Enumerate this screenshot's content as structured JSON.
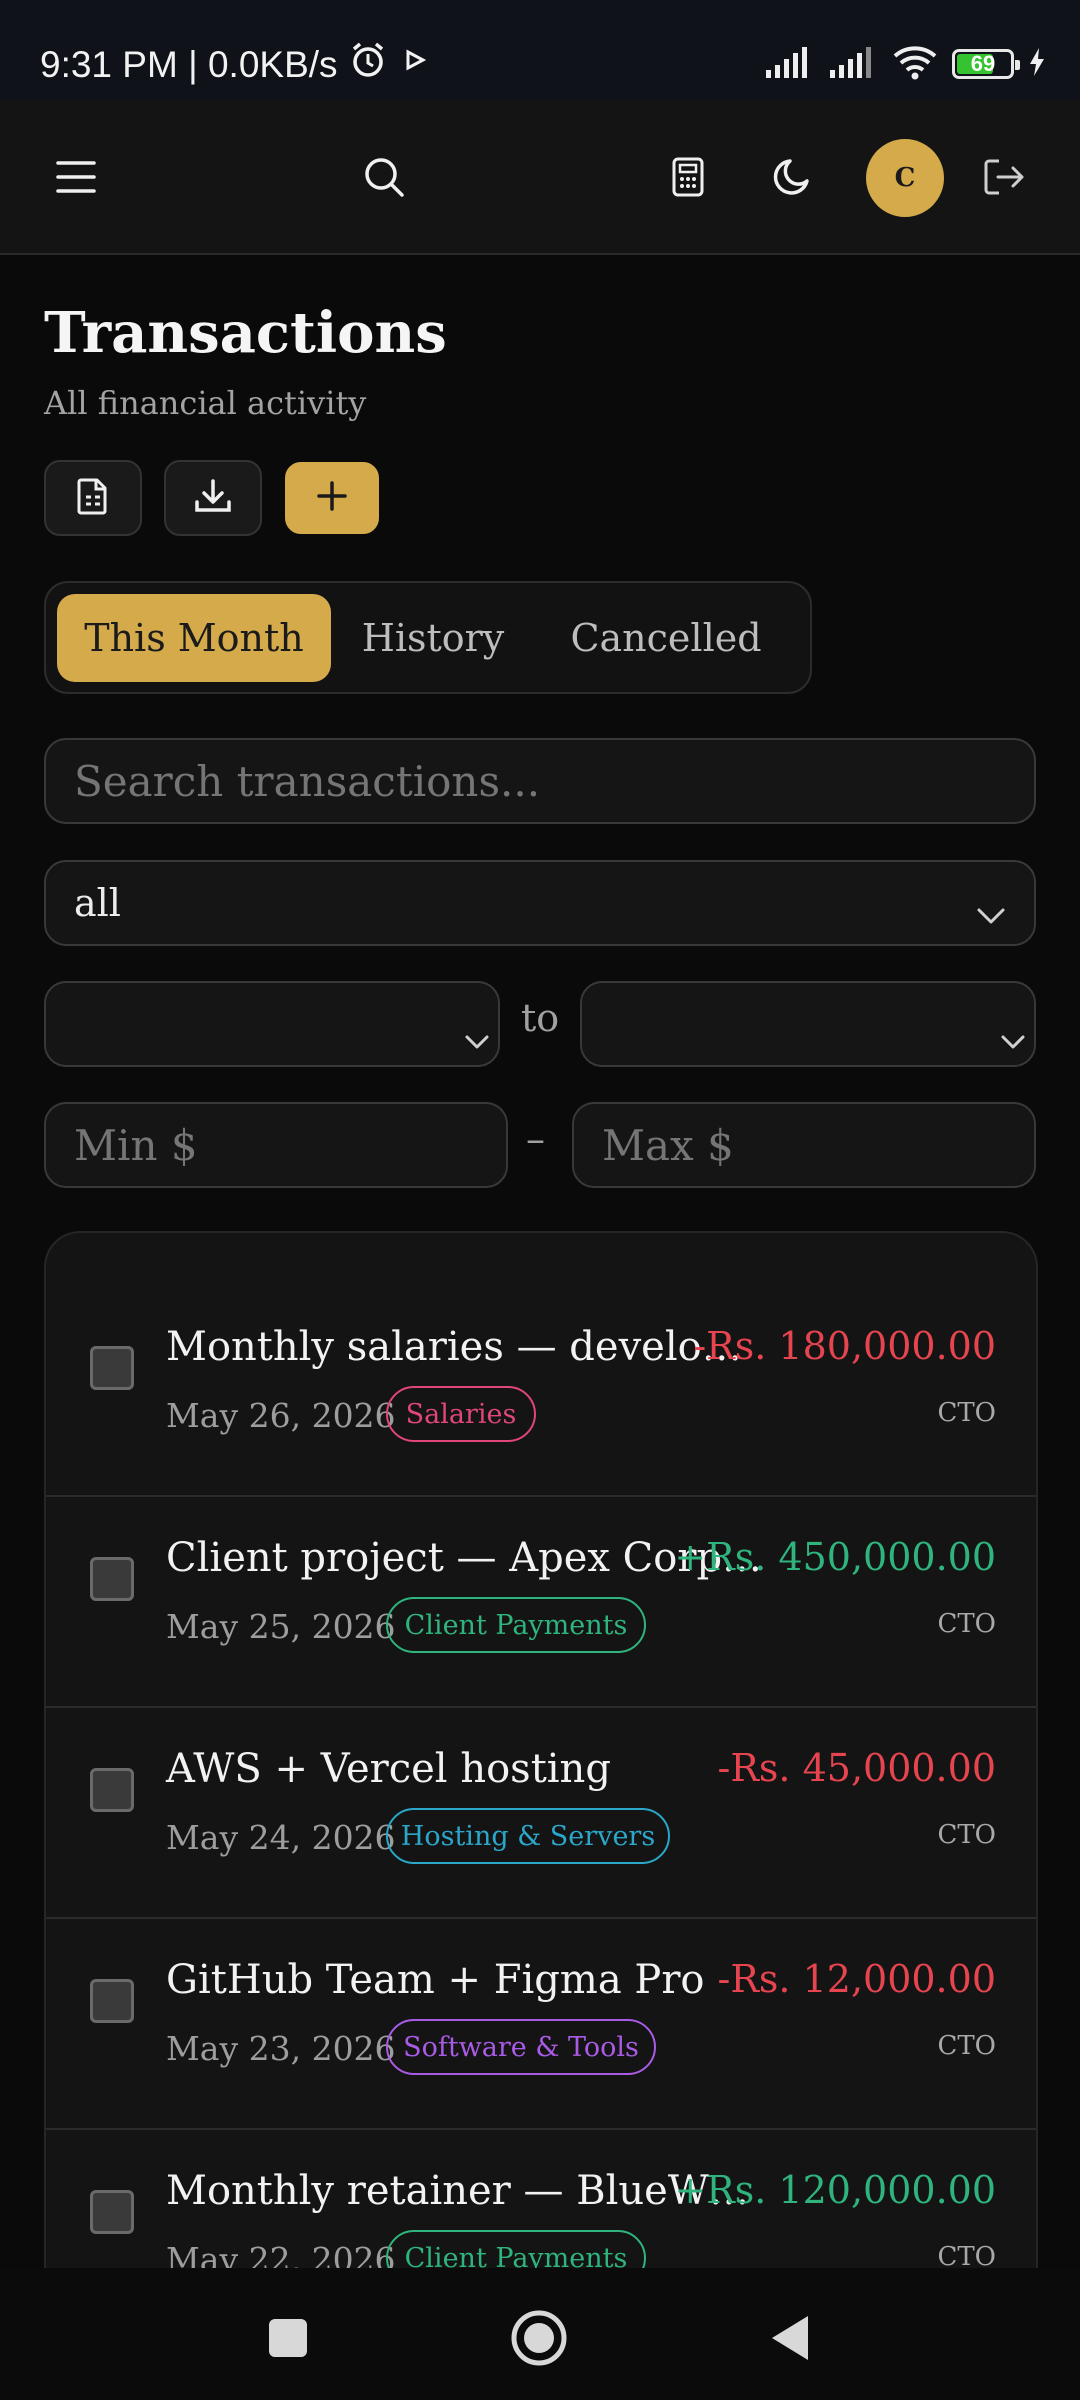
{
  "status_bar": {
    "time_info": "9:31 PM | 0.0KB/s",
    "battery": "69"
  },
  "header": {
    "menu_icon": "menu-icon",
    "search_icon": "search-icon",
    "calculator_icon": "calculator-icon",
    "theme_icon": "moon-icon",
    "avatar_initial": "C",
    "logout_icon": "logout-icon"
  },
  "page": {
    "title": "Transactions",
    "subtitle": "All financial activity"
  },
  "actions": {
    "report_icon": "document-icon",
    "download_icon": "download-icon",
    "add_icon": "plus-icon"
  },
  "tabs": [
    {
      "label": "This Month",
      "active": true
    },
    {
      "label": "History",
      "active": false
    },
    {
      "label": "Cancelled",
      "active": false
    }
  ],
  "filters": {
    "search_placeholder": "Search transactions...",
    "category_value": "all",
    "date_from": "",
    "date_separator": "to",
    "date_to": "",
    "min_placeholder": "Min $",
    "range_separator": "–",
    "max_placeholder": "Max $"
  },
  "transactions": [
    {
      "title": "Monthly salaries — develo…",
      "date": "May 26, 2026",
      "category": "Salaries",
      "amount": "-Rs. 180,000.00",
      "owner": "CTO",
      "type": "debit",
      "badge_color": "#e0457b"
    },
    {
      "title": "Client project — Apex Corp…",
      "date": "May 25, 2026",
      "category": "Client Payments",
      "amount": "+Rs. 450,000.00",
      "owner": "CTO",
      "type": "credit",
      "badge_color": "#2fb47d"
    },
    {
      "title": "AWS + Vercel hosting",
      "date": "May 24, 2026",
      "category": "Hosting & Servers",
      "amount": "-Rs. 45,000.00",
      "owner": "CTO",
      "type": "debit",
      "badge_color": "#2aa7c9"
    },
    {
      "title": "GitHub Team + Figma Pro",
      "date": "May 23, 2026",
      "category": "Software & Tools",
      "amount": "-Rs. 12,000.00",
      "owner": "CTO",
      "type": "debit",
      "badge_color": "#a95be6"
    },
    {
      "title": "Monthly retainer — BlueW…",
      "date": "May 22, 2026",
      "category": "Client Payments",
      "amount": "+Rs. 120,000.00",
      "owner": "CTO",
      "type": "credit",
      "badge_color": "#2fb47d"
    }
  ],
  "colors": {
    "accent": "#d4aa4a",
    "debit": "#e6454f",
    "credit": "#2fb47d"
  }
}
